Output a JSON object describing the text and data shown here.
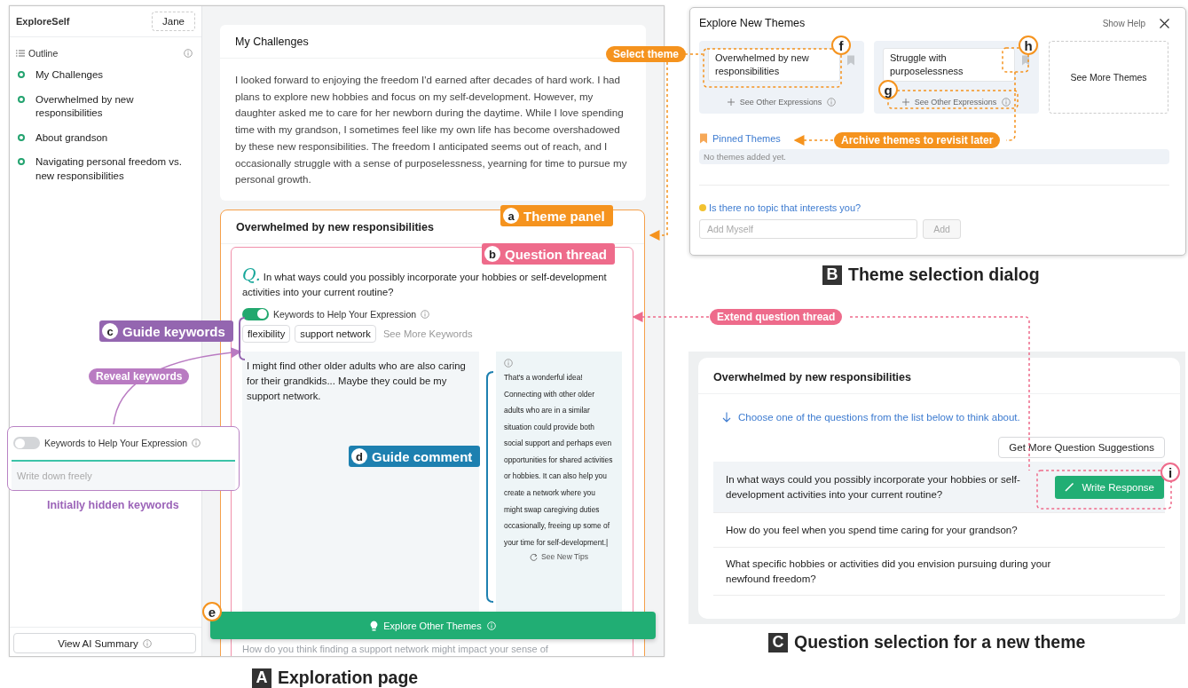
{
  "exploration_page": {
    "sidebar": {
      "app_name": "ExploreSelf",
      "user_button": "Jane",
      "outline_title": "Outline",
      "outline_items": [
        "My Challenges",
        "Overwhelmed by new responsibilities",
        "About grandson",
        "Navigating personal freedom vs. new responsibilities"
      ],
      "summary_button": "View AI Summary"
    },
    "challenge_card": {
      "title": "My Challenges",
      "body": "I looked forward to enjoying the freedom I'd earned after decades of hard work. I had plans to explore new hobbies and focus on my self-development. However, my daughter asked me to care for her newborn during the daytime. While I love spending time with my grandson, I sometimes feel like my own life has become overshadowed by these new responsibilities. The freedom I anticipated seems out of reach, and I occasionally struggle with a sense of purposelessness, yearning for time to pursue my personal growth."
    },
    "theme_panel": {
      "title": "Overwhelmed by new responsibilities",
      "question_mark": "Q.",
      "question": "In what ways could you possibly incorporate your hobbies or self-development activities into your current routine?",
      "keywords_toggle": {
        "label": "Keywords to Help Your Expression",
        "on": true
      },
      "keywords": [
        "flexibility",
        "support network"
      ],
      "more_keywords": "See More Keywords",
      "response": "I might find other older adults who are also caring for their grandkids... Maybe they could be my support network.",
      "guide_comment": {
        "text": "That's a wonderful idea! Connecting with other older adults who are in a similar situation could provide both social support and perhaps even opportunities for shared activities or hobbies. It can also help you create a network where you might swap caregiving duties occasionally, freeing up some of your time for self-development.|",
        "tips_button": "See New Tips"
      },
      "next_question": "How do you think finding a support network might impact your sense of"
    },
    "explore_button": "Explore Other Themes"
  },
  "hidden_keywords_popup": {
    "toggle_label": "Keywords to Help Your Expression",
    "on": false,
    "placeholder": "Write down freely"
  },
  "theme_dialog": {
    "title": "Explore New Themes",
    "help": "Show Help",
    "themes": [
      {
        "title": "Overwhelmed by new responsibilities",
        "expressions_button": "See Other Expressions"
      },
      {
        "title": "Struggle with purposelessness",
        "expressions_button": "See Other Expressions"
      }
    ],
    "more_themes": "See More Themes",
    "pinned_title": "Pinned Themes",
    "pinned_empty": "No themes added yet.",
    "prompt": "Is there no topic that interests you?",
    "input_placeholder": "Add Myself",
    "add_button": "Add"
  },
  "question_selection": {
    "title": "Overwhelmed by new responsibilities",
    "instruction": "Choose one of the questions from the list below to think about.",
    "more_button": "Get More Question Suggestions",
    "questions": [
      {
        "text": "In what ways could you possibly incorporate your hobbies or self-development activities into your current routine?",
        "selected": true,
        "action": "Write Response"
      },
      {
        "text": "How do you feel when you spend time caring for your grandson?",
        "selected": false
      },
      {
        "text": "What specific hobbies or activities did you envision pursuing during your newfound freedom?",
        "selected": false
      }
    ]
  },
  "annotations": [
    {
      "kind": "pill",
      "label": "Select theme",
      "color": "#f5931e"
    },
    {
      "kind": "tag",
      "badge": "a",
      "label": "Theme panel",
      "color": "#f5931e"
    },
    {
      "kind": "tag",
      "badge": "b",
      "label": "Question thread",
      "color": "#ee6b8b"
    },
    {
      "kind": "tag",
      "badge": "c",
      "label": "Guide keywords",
      "color": "#9466b0"
    },
    {
      "kind": "pill",
      "label": "Reveal keywords",
      "color": "#b97bc2"
    },
    {
      "kind": "note",
      "label": "Initially hidden keywords",
      "color": "#9b63b8"
    },
    {
      "kind": "tag",
      "badge": "d",
      "label": "Guide comment",
      "color": "#1d80b0"
    },
    {
      "kind": "marker",
      "badge": "e",
      "color": "#f5931e"
    },
    {
      "kind": "marker",
      "badge": "f",
      "color": "#f5931e"
    },
    {
      "kind": "marker",
      "badge": "g",
      "color": "#f5931e"
    },
    {
      "kind": "marker",
      "badge": "h",
      "color": "#f5931e"
    },
    {
      "kind": "pill",
      "label": "Archive themes to revisit later",
      "color": "#f5931e"
    },
    {
      "kind": "pill",
      "label": "Extend question thread",
      "color": "#ee6b8b"
    },
    {
      "kind": "marker",
      "badge": "i",
      "color": "#ee6b8b"
    }
  ],
  "captions": [
    {
      "letter": "A",
      "text": "Exploration page"
    },
    {
      "letter": "B",
      "text": "Theme selection dialog"
    },
    {
      "letter": "C",
      "text": "Question selection for a new theme"
    }
  ]
}
